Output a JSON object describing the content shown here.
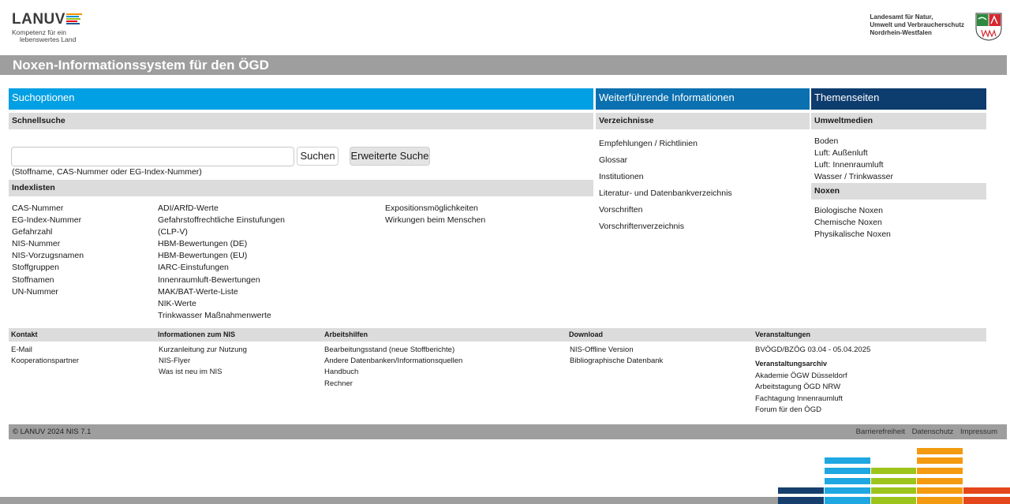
{
  "header": {
    "logo_word": "LANUV",
    "logo_tagline_1": "Kompetenz für ein",
    "logo_tagline_2": "lebenswertes Land",
    "agency_line_1": "Landesamt für Natur,",
    "agency_line_2": "Umwelt und Verbraucherschutz",
    "agency_line_3": "Nordrhein-Westfalen",
    "colors": {
      "logo_bars": [
        "#f39200",
        "#0093d6",
        "#95c11f",
        "#e30613",
        "#1d5a96"
      ]
    }
  },
  "title": "Noxen-Informationssystem für den ÖGD",
  "columns": {
    "search": {
      "title": "Suchoptionen",
      "color": "#019fe3"
    },
    "info": {
      "title": "Weiterführende Informationen",
      "color": "#0a70b0"
    },
    "themes": {
      "title": "Themenseiten",
      "color": "#0d3c6e"
    }
  },
  "quicksearch": {
    "heading": "Schnellsuche",
    "input_value": "",
    "search_button": "Suchen",
    "advanced_button": "Erweiterte Suche",
    "hint": "(Stoffname, CAS-Nummer oder EG-Index-Nummer)"
  },
  "indexlists": {
    "heading": "Indexlisten",
    "col1": [
      "CAS-Nummer",
      "EG-Index-Nummer",
      "Gefahrzahl",
      "NIS-Nummer",
      "NIS-Vorzugsnamen",
      "Stoffgruppen",
      "Stoffnamen",
      "UN-Nummer"
    ],
    "col2": [
      "ADI/ARfD-Werte",
      "Gefahrstoffrechtliche Einstufungen",
      "(CLP-V)",
      "HBM-Bewertungen (DE)",
      "HBM-Bewertungen (EU)",
      "IARC-Einstufungen",
      "Innenraumluft-Bewertungen",
      "MAK/BAT-Werte-Liste",
      "NIK-Werte",
      "Trinkwasser Maßnahmenwerte"
    ],
    "col3": [
      "Expositionsmöglichkeiten",
      "Wirkungen beim Menschen"
    ]
  },
  "directories": {
    "heading": "Verzeichnisse",
    "items": [
      "Empfehlungen / Richtlinien",
      "Glossar",
      "Institutionen",
      "Literatur- und Datenbankverzeichnis",
      "Vorschriften",
      "Vorschriftenverzeichnis"
    ]
  },
  "themes": {
    "media_heading": "Umweltmedien",
    "media": [
      "Boden",
      "Luft: Außenluft",
      "Luft: Innenraumluft",
      "Wasser / Trinkwasser"
    ],
    "noxen_heading": "Noxen",
    "noxen": [
      "Biologische Noxen",
      "Chemische Noxen",
      "Physikalische Noxen"
    ]
  },
  "footer": {
    "kontakt": {
      "heading": "Kontakt",
      "items": [
        "E-Mail",
        "Kooperationspartner"
      ]
    },
    "nis_info": {
      "heading": "Informationen zum NIS",
      "items": [
        "Kurzanleitung zur Nutzung",
        "NIS-Flyer",
        "Was ist neu im NIS"
      ]
    },
    "tools": {
      "heading": "Arbeitshilfen",
      "items": [
        "Bearbeitungsstand (neue Stoffberichte)",
        "Andere Datenbanken/Informationsquellen",
        "Handbuch",
        "Rechner"
      ]
    },
    "download": {
      "heading": "Download",
      "items": [
        "NIS-Offline Version",
        "Bibliographische Datenbank"
      ]
    },
    "events": {
      "heading": "Veranstaltungen",
      "items": [
        "BVÖGD/BZÖG 03.04 - 05.04.2025"
      ],
      "archive_heading": "Veranstaltungsarchiv",
      "archive": [
        "Akademie ÖGW Düsseldorf",
        "Arbeitstagung ÖGD NRW",
        "Fachtagung Innenraumluft",
        "Forum für den ÖGD"
      ]
    }
  },
  "bottom": {
    "copyright": "© LANUV 2024 NIS 7.1",
    "links": [
      "Barrierefreiheit",
      "Datenschutz",
      "Impressum"
    ]
  },
  "decoration_colors": {
    "dark_blue": "#173f6e",
    "light_blue": "#1ea7e1",
    "green": "#9dc41a",
    "orange": "#f39a10",
    "red": "#e4471b"
  }
}
